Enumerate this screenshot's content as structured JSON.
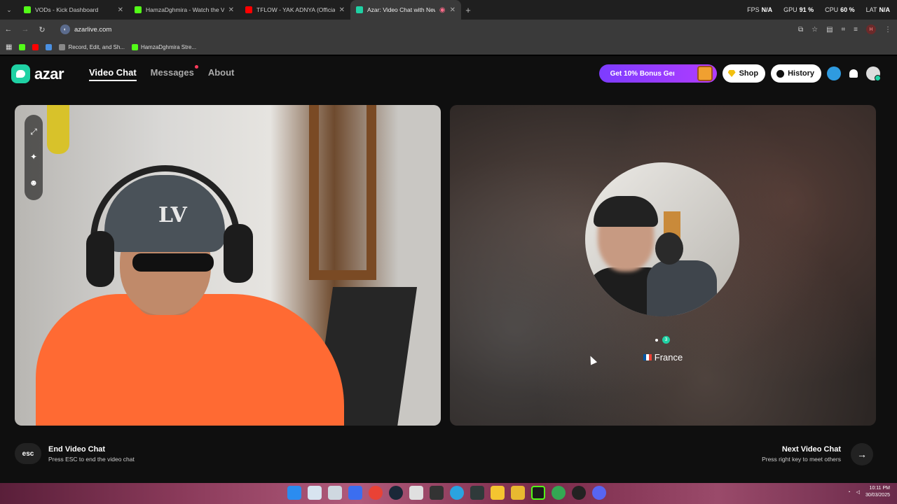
{
  "browser": {
    "tabs": [
      {
        "title": "VODs - Kick Dashboard",
        "color": "#53fc18",
        "active": false
      },
      {
        "title": "HamzaDghmira - Watch the VO",
        "color": "#53fc18",
        "active": false
      },
      {
        "title": "TFLOW - YAK ADNYA (Official M",
        "color": "#ff0000",
        "active": false
      },
      {
        "title": "Azar: Video Chat with New",
        "color": "#1fd1a4",
        "active": true
      }
    ],
    "perf": [
      {
        "k": "FPS",
        "v": "N/A"
      },
      {
        "k": "GPU",
        "v": "91 %"
      },
      {
        "k": "CPU",
        "v": "60 %"
      },
      {
        "k": "LAT",
        "v": "N/A"
      }
    ],
    "url": "azarlive.com",
    "bookmarks": [
      {
        "label": "",
        "color": "#53fc18"
      },
      {
        "label": "",
        "color": "#ff0000"
      },
      {
        "label": "",
        "color": "#4a90e2"
      },
      {
        "label": "Record, Edit, and Sh...",
        "color": "#888"
      },
      {
        "label": "HamzaDghmira Stre...",
        "color": "#53fc18"
      }
    ]
  },
  "header": {
    "logo": "azar",
    "nav": {
      "video_chat": "Video Chat",
      "messages": "Messages",
      "about": "About"
    },
    "promo": "Get 10% Bonus Geı",
    "shop": "Shop",
    "history": "History"
  },
  "partner": {
    "country": "France",
    "badge": "3"
  },
  "controls": {
    "esc_label": "esc",
    "end_title": "End Video Chat",
    "end_sub": "Press ESC to end the video chat",
    "next_title": "Next Video Chat",
    "next_sub": "Press right key to meet others"
  },
  "taskbar": {
    "time": "10:11 PM",
    "date": "30/03/2025"
  }
}
